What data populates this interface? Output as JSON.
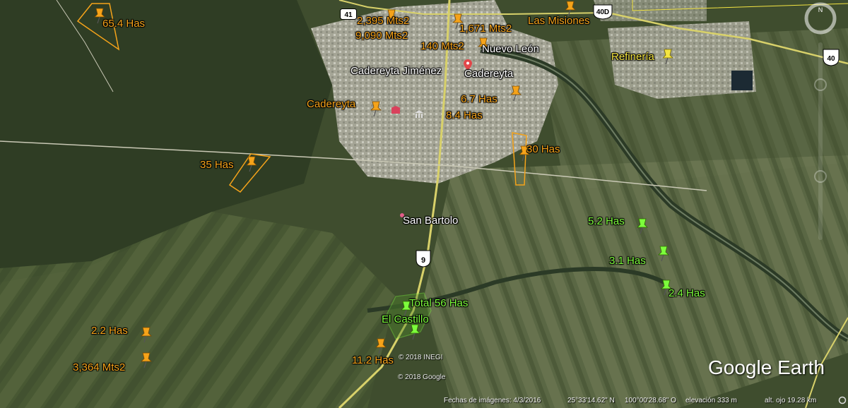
{
  "map": {
    "labels": {
      "has_65_4": "65.4 Has",
      "mts2_2395": "2,395 Mts2",
      "mts2_9090": "9,090 Mts2",
      "mts2_1671": "1,671 Mts2",
      "las_misiones": "Las Misiones",
      "mts2_140": "140 Mts2",
      "nuevo_leon": "Nuevo León",
      "refineria": "Refinería",
      "cadereyta_jimenez": "Cadereyta Jiménez",
      "cadereyta_city": "Cadereyta",
      "cadereyta_pin": "Cadereyta",
      "has_6_7": "6.7 Has",
      "has_8_4": "8.4 Has",
      "has_30": "30 Has",
      "has_35": "35 Has",
      "san_bartolo": "San Bartolo",
      "has_5_2": "5.2 Has",
      "has_3_1": "3.1 Has",
      "has_2_4": "2.4 Has",
      "total_56": "Total 56 Has",
      "el_castillo": "El Castillo",
      "has_2_2": "2.2 Has",
      "mts2_3364": "3,364 Mts2",
      "has_11_2": "11.2 Has"
    },
    "shields": {
      "hwy_41": "41",
      "hwy_40d": "40D",
      "hwy_40": "40",
      "hwy_9": "9"
    },
    "copyright": {
      "inegi": "© 2018 INEGI",
      "google": "© 2018 Google"
    },
    "brand": "Google Earth",
    "colors": {
      "owned_marker": "#f5a31a",
      "green_marker": "#7dfc3c",
      "yellow_marker": "#f4e542"
    }
  },
  "statusbar": {
    "imagery_date": "Fechas de imágenes: 4/3/2016",
    "latitude": "25°33'14.62\" N",
    "longitude": "100°00'28.68\" O",
    "elevation": "elevación   333 m",
    "eye_alt": "alt. ojo  19.28 km"
  }
}
